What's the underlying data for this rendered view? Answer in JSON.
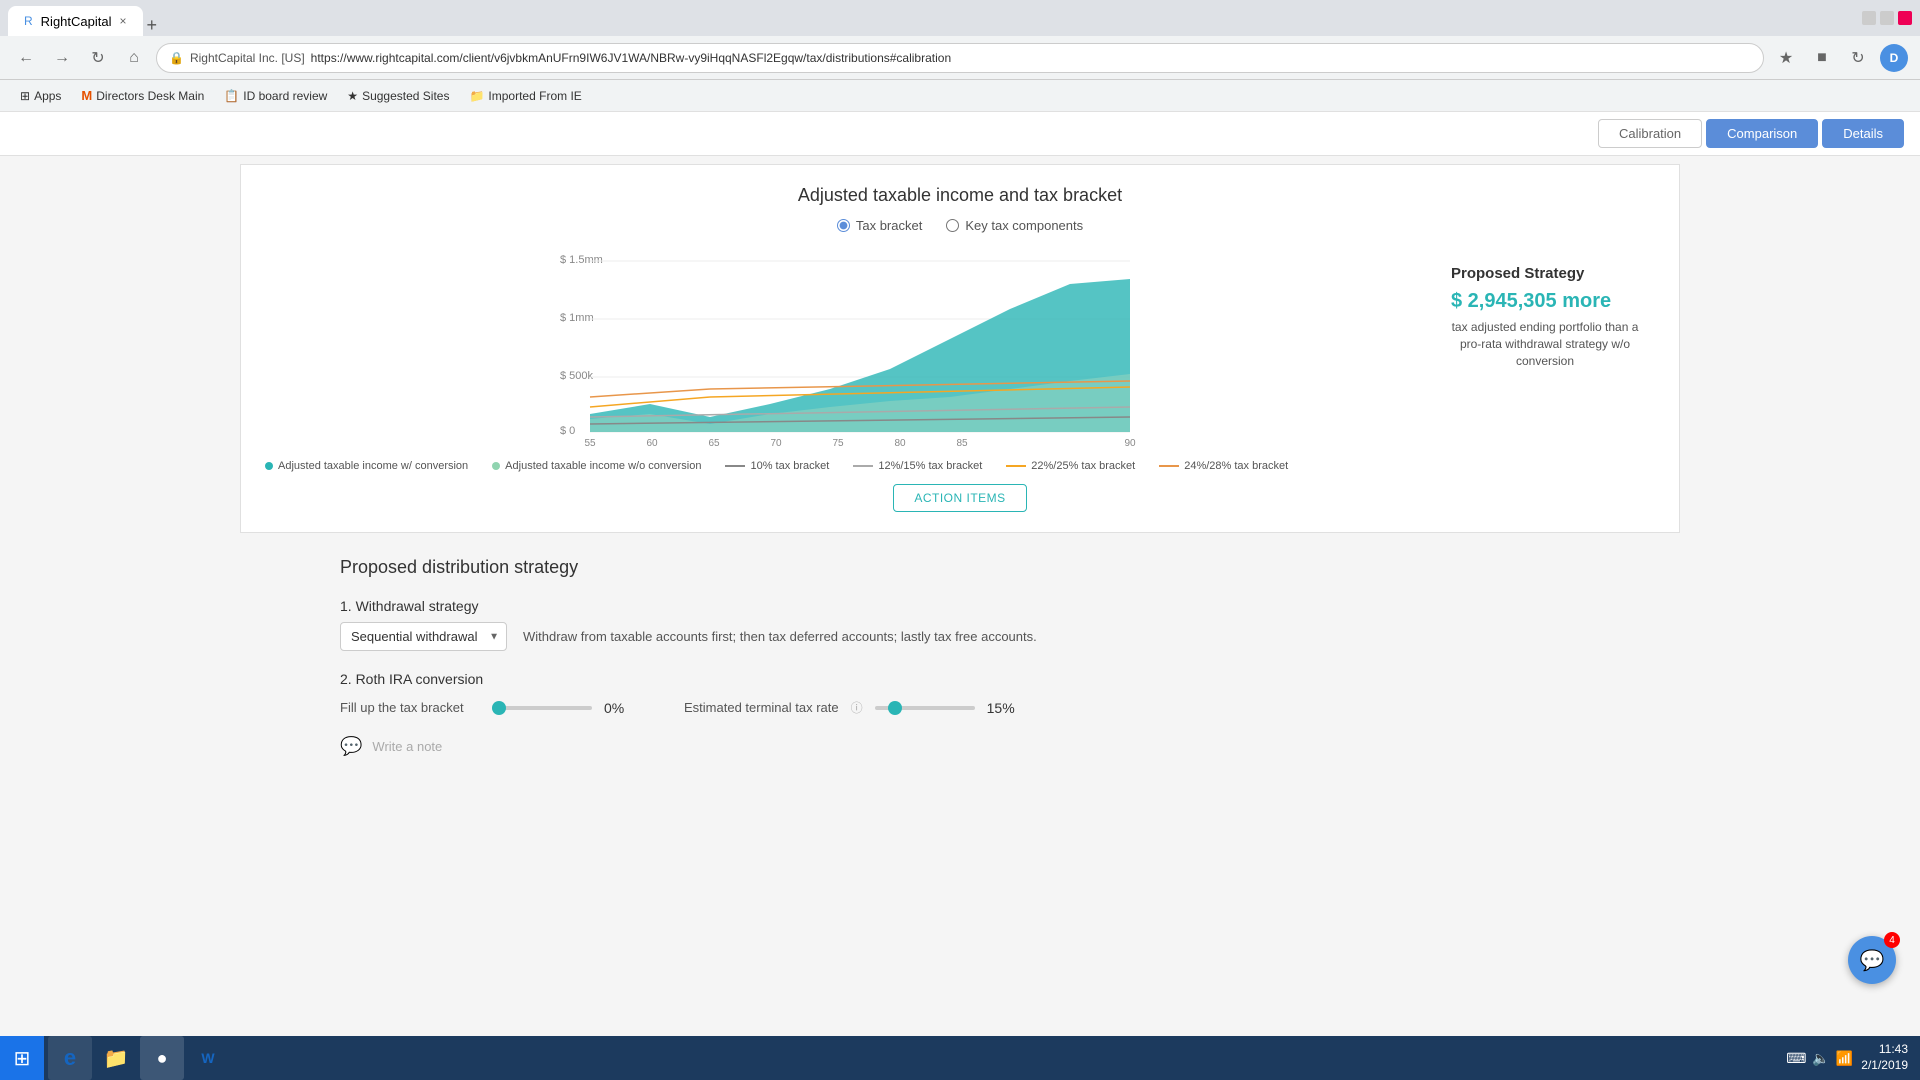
{
  "browser": {
    "tab_title": "RightCapital",
    "tab_close": "×",
    "tab_new": "+",
    "url": "https://www.rightcapital.com/client/v6jvbkmAnUFrn9IW6JV1WA/NBRw-vy9iHqqNASFl2Egqw/tax/distributions#calibration",
    "url_security": "RightCapital Inc. [US]",
    "bookmarks": [
      {
        "icon": "⊞",
        "label": "Apps"
      },
      {
        "icon": "M",
        "label": "Directors Desk Main"
      },
      {
        "icon": "📋",
        "label": "ID board review"
      },
      {
        "icon": "★",
        "label": "Suggested Sites"
      },
      {
        "icon": "📁",
        "label": "Imported From IE"
      }
    ]
  },
  "tabs": {
    "calibration": "Calibration",
    "comparison": "Comparison",
    "details": "Details",
    "active": "comparison"
  },
  "chart": {
    "title": "Adjusted taxable income and tax bracket",
    "radio_tax_bracket": "Tax bracket",
    "radio_key_tax": "Key tax components",
    "selected_radio": "tax_bracket",
    "y_labels": [
      "$ 1.5mm",
      "$ 1mm",
      "$ 500k",
      "$ 0"
    ],
    "x_labels": [
      "55",
      "60",
      "65",
      "70",
      "75",
      "80",
      "85",
      "90"
    ],
    "legend": [
      {
        "type": "dot",
        "color": "#2ab5b5",
        "label": "Adjusted taxable income w/ conversion"
      },
      {
        "type": "dot",
        "color": "#90d4b0",
        "label": "Adjusted taxable income w/o conversion"
      },
      {
        "type": "line",
        "color": "#888888",
        "label": "10% tax bracket"
      },
      {
        "type": "line",
        "color": "#aaaaaa",
        "label": "12%/15% tax bracket"
      },
      {
        "type": "line",
        "color": "#f5a623",
        "label": "22%/25% tax bracket"
      },
      {
        "type": "line",
        "color": "#e8964a",
        "label": "24%/28% tax bracket"
      }
    ],
    "action_items_btn": "ACTION ITEMS"
  },
  "proposed_strategy": {
    "title": "Proposed Strategy",
    "amount": "$ 2,945,305 more",
    "description": "tax adjusted ending portfolio than a pro-rata withdrawal strategy w/o conversion"
  },
  "distribution": {
    "title": "Proposed distribution strategy",
    "withdrawal_label": "1. Withdrawal strategy",
    "withdrawal_value": "Sequential withdrawal",
    "withdrawal_description": "Withdraw from taxable accounts first; then tax deferred accounts; lastly tax free accounts.",
    "roth_label": "2. Roth IRA conversion",
    "fill_bracket_label": "Fill up the tax bracket",
    "fill_bracket_value": "0%",
    "terminal_tax_label": "Estimated terminal tax rate",
    "terminal_tax_value": "15%",
    "fill_bracket_pct": 0,
    "terminal_tax_pct": 15,
    "notes_placeholder": "Write a note"
  },
  "taskbar": {
    "time": "11:43",
    "date": "2/1/2019",
    "notification_count": "4"
  }
}
